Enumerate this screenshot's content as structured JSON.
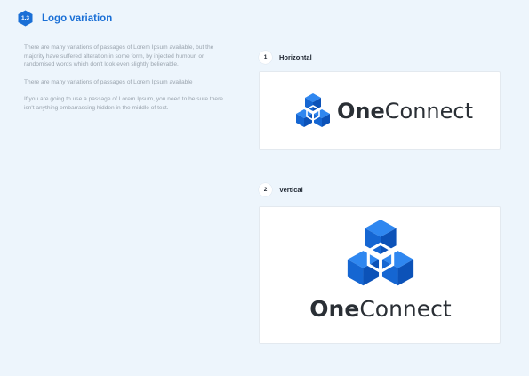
{
  "section": {
    "number": "1.3",
    "title": "Logo variation"
  },
  "description": {
    "paragraphs": [
      "There are many variations of passages of Lorem Ipsum available, but the majority have suffered alteration in some form, by injected humour, or randomised words which don't look even slightly believable.",
      "There are many variations of passages of Lorem Ipsum available",
      "If you are going to use a passage of Lorem Ipsum, you need to be sure there isn't anything embarrassing hidden in the middle of text."
    ]
  },
  "variants": [
    {
      "number": "1",
      "label": "Horizontal"
    },
    {
      "number": "2",
      "label": "Vertical"
    }
  ],
  "logo": {
    "word_bold": "One",
    "word_regular": "Connect"
  },
  "colors": {
    "accent": "#1a6fd6",
    "cube_top": "#2f87f0",
    "cube_left": "#1566d2",
    "cube_right": "#0c52b8",
    "background": "#edf5fc"
  }
}
